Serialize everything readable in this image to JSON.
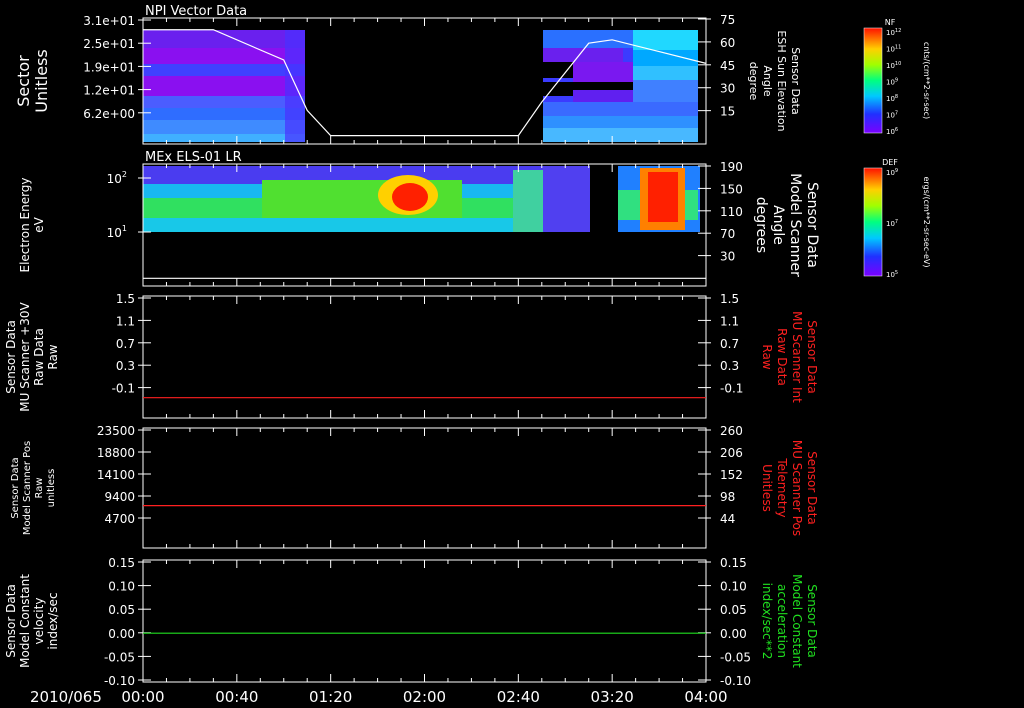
{
  "date_label": "2010/065",
  "x_ticks": [
    "00:00",
    "00:40",
    "01:20",
    "02:00",
    "02:40",
    "03:20",
    "04:00"
  ],
  "panels": [
    {
      "title": "NPI Vector Data",
      "left_label": [
        "Sector",
        "Unitless"
      ],
      "left_ticks": [
        "3.1e+01",
        "2.5e+01",
        "1.9e+01",
        "1.2e+01",
        "6.2e+00"
      ],
      "right_label": [
        "Sensor Data",
        "ESH Sun Elevation",
        "Angle",
        "degree"
      ],
      "right_ticks": [
        "75",
        "60",
        "45",
        "30",
        "15"
      ],
      "line_color": "#ffffff"
    },
    {
      "title": "MEx ELS-01 LR",
      "left_label": [
        "Electron Energy",
        "eV"
      ],
      "left_ticks": [
        "10^2",
        "10^1"
      ],
      "right_label": [
        "Sensor Data",
        "Model Scanner",
        "Angle",
        "degrees"
      ],
      "right_ticks": [
        "190",
        "150",
        "110",
        "70",
        "30"
      ],
      "line_color": "#ffffff"
    },
    {
      "title": "",
      "left_label": [
        "Sensor Data",
        "MU Scanner +30V",
        "Raw Data",
        "Raw"
      ],
      "left_ticks": [
        "1.5",
        "1.1",
        "0.7",
        "0.3",
        "-0.1"
      ],
      "right_label": [
        "Sensor Data",
        "MU Scanner Int",
        "Raw Data",
        "Raw"
      ],
      "right_ticks": [
        "1.5",
        "1.1",
        "0.7",
        "0.3",
        "-0.1"
      ],
      "line_color": "#ff2020",
      "right_label_color": "#ff2020"
    },
    {
      "title": "",
      "left_label": [
        "Sensor Data",
        "Model Scanner Pos",
        "Raw",
        "unitless"
      ],
      "left_ticks": [
        "23500",
        "18800",
        "14100",
        "9400",
        "4700"
      ],
      "right_label": [
        "Sensor Data",
        "MU Scanner Pos",
        "Telemetry",
        "Unitless"
      ],
      "right_ticks": [
        "260",
        "206",
        "152",
        "98",
        "44"
      ],
      "line_color": "#ff2020",
      "right_label_color": "#ff2020"
    },
    {
      "title": "",
      "left_label": [
        "Sensor Data",
        "Model Constant",
        "velocity",
        "index/sec"
      ],
      "left_ticks": [
        "0.15",
        "0.10",
        "0.05",
        "0.00",
        "-0.05",
        "-0.10"
      ],
      "right_label": [
        "Sensor Data",
        "Model Constant",
        "acceleration",
        "index/sec**2"
      ],
      "right_ticks": [
        "0.15",
        "0.10",
        "0.05",
        "0.00",
        "-0.05",
        "-0.10"
      ],
      "line_color": "#20e020",
      "right_label_color": "#20e020"
    }
  ],
  "colorbars": [
    {
      "label": "NF",
      "ticks": [
        "10^12",
        "10^11",
        "10^10",
        "10^9",
        "10^8",
        "10^7",
        "10^6"
      ],
      "units": "cnts/(cm**2-sr-sec)"
    },
    {
      "label": "DEF",
      "ticks": [
        "10^9",
        "10^7",
        "10^5"
      ],
      "units": "ergs/(cm**2-sr-sec-eV)"
    }
  ],
  "chart_data": [
    {
      "type": "heatmap",
      "title": "NPI Vector Data",
      "x_range": [
        "00:00",
        "04:00"
      ],
      "ylabel": "Sector Unitless",
      "y_tick_labels": [
        "3.1e+01",
        "2.5e+01",
        "1.9e+01",
        "1.2e+01",
        "6.2e+00"
      ],
      "overlay_line": {
        "name": "Sensor Data ESH Sun Elevation Angle",
        "units": "degree",
        "ylim": [
          0,
          75
        ],
        "x": [
          "00:00",
          "00:30",
          "01:00",
          "01:10",
          "01:20",
          "02:00",
          "02:40",
          "02:50",
          "03:10",
          "03:20",
          "03:40",
          "04:00"
        ],
        "y": [
          68,
          68,
          50,
          20,
          5,
          5,
          5,
          25,
          60,
          62,
          55,
          48
        ]
      }
    },
    {
      "type": "heatmap",
      "title": "MEx ELS-01 LR",
      "x_range": [
        "00:00",
        "04:00"
      ],
      "ylabel": "Electron Energy eV",
      "y_scale": "log",
      "overlay_line": {
        "name": "Sensor Data Model Scanner Angle",
        "units": "degrees",
        "ylim": [
          0,
          190
        ],
        "x": [
          "00:00",
          "04:00"
        ],
        "y": [
          12,
          12
        ]
      }
    },
    {
      "type": "line",
      "x_range": [
        "00:00",
        "04:00"
      ],
      "ylim": [
        -0.3,
        1.5
      ],
      "series": [
        {
          "name": "Sensor Data MU Scanner +30V Raw Data",
          "x": [
            "00:00",
            "04:00"
          ],
          "values": [
            0.0,
            0.0
          ]
        }
      ]
    },
    {
      "type": "line",
      "x_range": [
        "00:00",
        "04:00"
      ],
      "ylim": [
        0,
        23500
      ],
      "series": [
        {
          "name": "Sensor Data Model Scanner Pos Raw",
          "x": [
            "00:00",
            "04:00"
          ],
          "values": [
            8300,
            8300
          ]
        }
      ]
    },
    {
      "type": "line",
      "x_range": [
        "00:00",
        "04:00"
      ],
      "ylim": [
        -0.1,
        0.15
      ],
      "series": [
        {
          "name": "Sensor Data Model Constant velocity",
          "x": [
            "00:00",
            "04:00"
          ],
          "values": [
            0.0,
            0.0
          ]
        }
      ]
    }
  ]
}
